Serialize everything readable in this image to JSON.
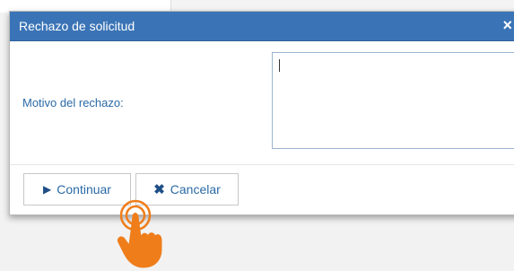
{
  "dialog": {
    "title": "Rechazo de solicitud",
    "close_icon_label": "×"
  },
  "form": {
    "field_label": "Motivo del rechazo:",
    "textarea_value": ""
  },
  "buttons": {
    "continue_label": "Continuar",
    "cancel_label": "Cancelar",
    "continue_icon": "play-icon",
    "cancel_icon": "close-icon"
  },
  "colors": {
    "titlebar": "#3b74b6",
    "accent_text": "#2b6aa6",
    "hand": "#ef7d1a"
  }
}
